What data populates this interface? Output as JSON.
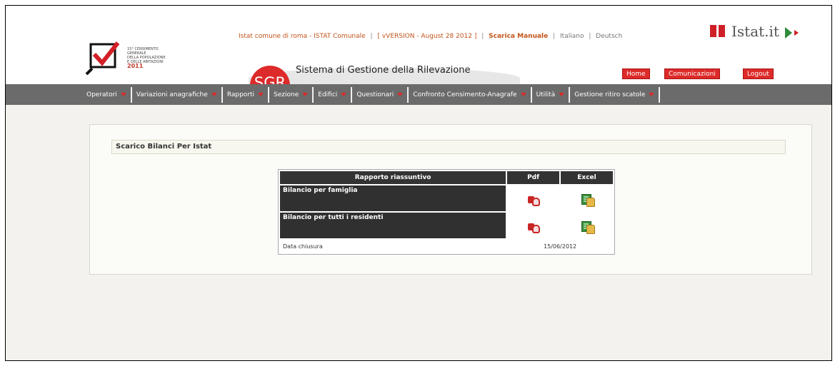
{
  "header": {
    "logo": {
      "year": "2011",
      "lines": [
        "15° CENSIMENTO GENERALE",
        "DELLA POPOLAZIONE",
        "E DELLE ABITAZIONI"
      ]
    },
    "top_links": {
      "user": "Istat comune di roma",
      "role": "ISTAT Comunale",
      "version": "[ vVERSION - August 28 2012 ]",
      "manual": "Scarica Manuale",
      "lang_it": "Italiano",
      "lang_de": "Deutsch"
    },
    "istat_logo": "Istat.it",
    "sgr_badge": "SGR",
    "sgr_title": "Sistema di Gestione della Rilevazione",
    "buttons": {
      "home": "Home",
      "comunicazioni": "Comunicazioni",
      "logout": "Logout"
    },
    "accent_color": "#dd2a2a"
  },
  "nav": {
    "items": [
      {
        "label": "Operatori"
      },
      {
        "label": "Variazioni anagrafiche"
      },
      {
        "label": "Rapporti"
      },
      {
        "label": "Sezione"
      },
      {
        "label": "Edifici"
      },
      {
        "label": "Questionari"
      },
      {
        "label": "Confronto Censimento-Anagrafe"
      },
      {
        "label": "Utilità"
      },
      {
        "label": "Gestione ritiro scatole"
      }
    ]
  },
  "main": {
    "section_title": "Scarico Bilanci Per Istat",
    "table": {
      "headers": {
        "report": "Rapporto riassuntivo",
        "pdf": "Pdf",
        "excel": "Excel"
      },
      "rows": [
        {
          "label": "Bilancio per famiglia",
          "pdf_icon": "pdf-lock-icon",
          "excel_icon": "excel-lock-icon"
        },
        {
          "label": "Bilancio per tutti i residenti",
          "pdf_icon": "pdf-lock-icon",
          "excel_icon": "excel-lock-icon"
        }
      ],
      "footer": {
        "label": "Data chiusura",
        "value": "15/06/2012"
      }
    }
  }
}
